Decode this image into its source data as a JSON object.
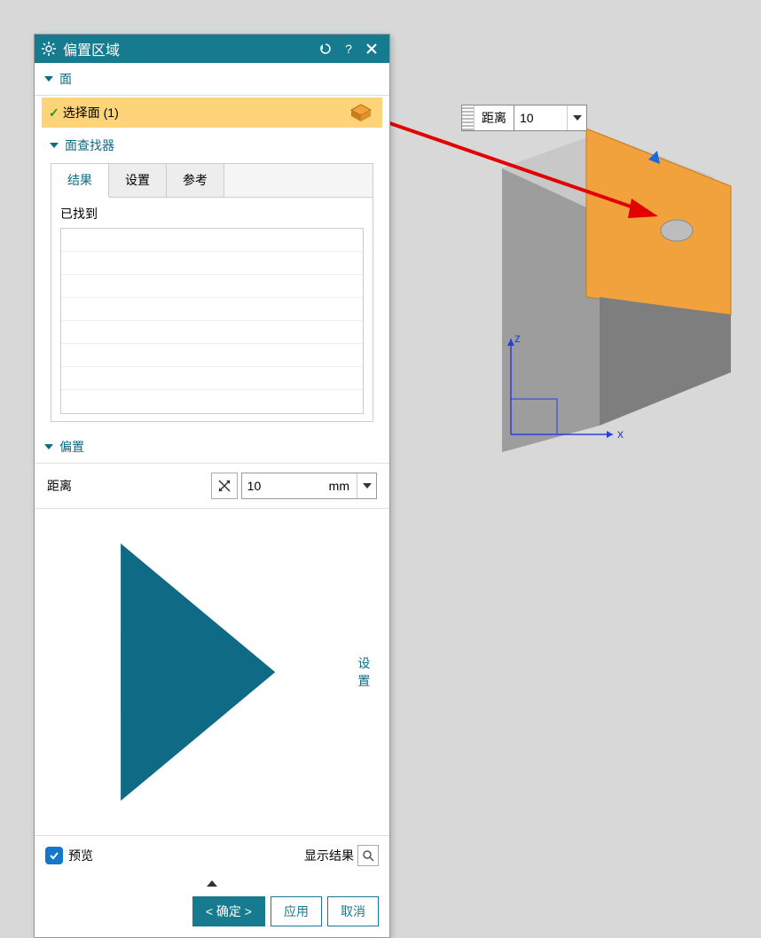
{
  "titlebar": {
    "title": "偏置区域"
  },
  "sections": {
    "face": {
      "header": "面",
      "select_face_label": "选择面 (1)",
      "finder_header": "面查找器",
      "tabs": {
        "results": "结果",
        "settings": "设置",
        "reference": "参考"
      },
      "found_label": "已找到"
    },
    "offset": {
      "header": "偏置",
      "distance_label": "距离",
      "distance_value": "10",
      "unit": "mm"
    },
    "settings": {
      "header": "设置"
    }
  },
  "preview": {
    "label": "预览",
    "show_result": "显示结果"
  },
  "buttons": {
    "ok": "确定",
    "apply": "应用",
    "cancel": "取消"
  },
  "float": {
    "label": "距离",
    "value": "10"
  },
  "axes": {
    "x": "x",
    "z": "z"
  }
}
